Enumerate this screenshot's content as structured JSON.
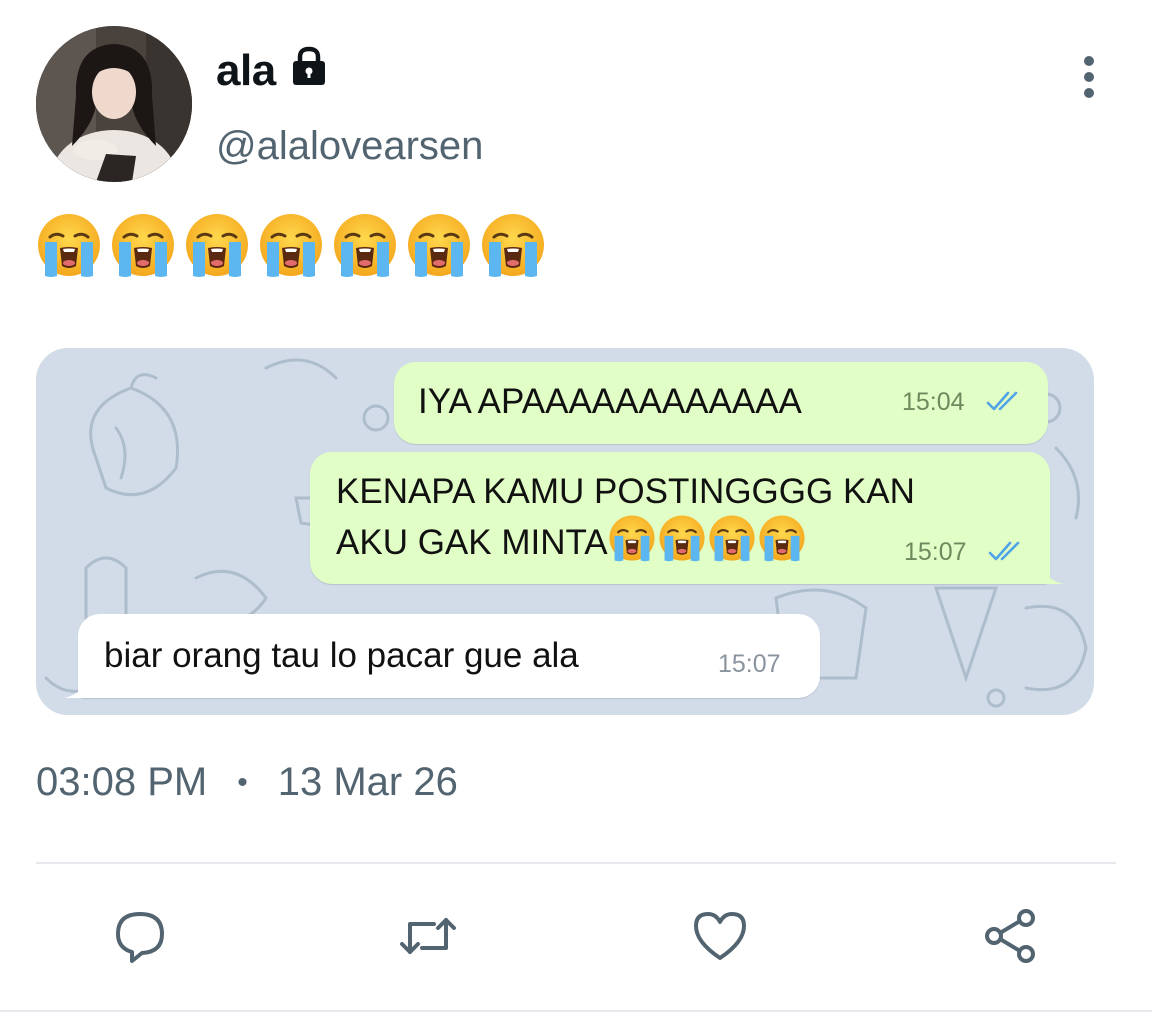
{
  "author": {
    "display_name": "ala",
    "handle": "@alalovearsen",
    "protected": true,
    "protected_icon": "lock-icon"
  },
  "tweet": {
    "emoji_text": "😭😭😭😭😭😭😭",
    "emoji_count": 7,
    "timestamp": "03:08 PM",
    "separator": "•",
    "date": "13 Mar 26"
  },
  "chat_screenshot": {
    "messages": [
      {
        "direction": "outgoing",
        "text": "IYA APAAAAAAAAAAAA",
        "time": "15:04",
        "read": true
      },
      {
        "direction": "outgoing",
        "text": "KENAPA KAMU POSTINGGGG KAN\nAKU GAK MINTA",
        "emoji": "😭😭😭😭",
        "time": "15:07",
        "read": true
      },
      {
        "direction": "incoming",
        "text": "biar orang tau lo pacar gue ala",
        "time": "15:07"
      }
    ]
  },
  "actions": [
    {
      "name": "reply",
      "icon": "reply-icon"
    },
    {
      "name": "retweet",
      "icon": "retweet-icon"
    },
    {
      "name": "like",
      "icon": "heart-icon"
    },
    {
      "name": "share",
      "icon": "share-icon"
    }
  ],
  "colors": {
    "text_primary": "#0f1419",
    "text_secondary": "#536471",
    "outgoing_bubble": "#e1fec6",
    "incoming_bubble": "#ffffff",
    "chat_background": "#d1dce8",
    "read_ticks": "#4fa3e6"
  }
}
